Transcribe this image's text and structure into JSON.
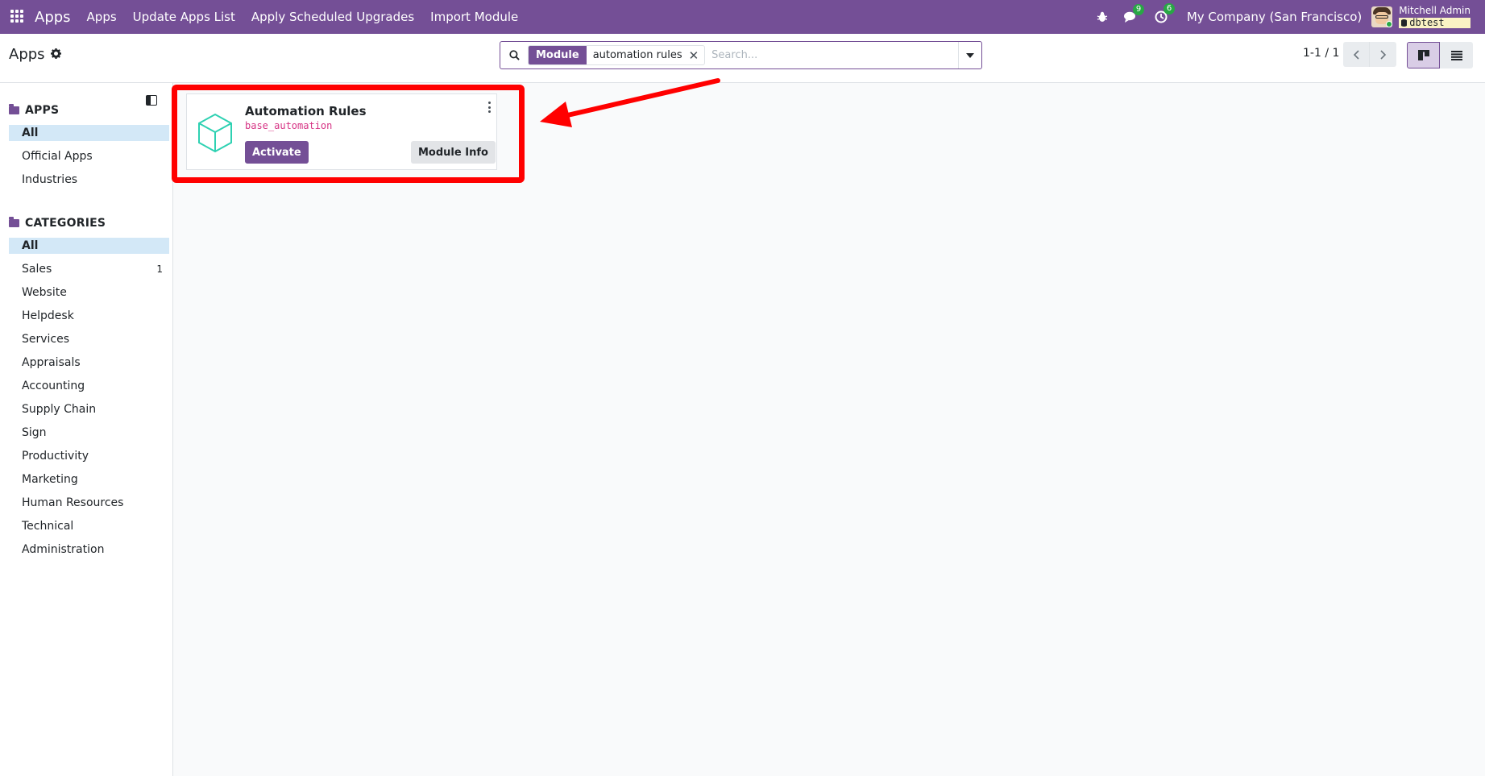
{
  "navbar": {
    "brand": "Apps",
    "menu": [
      "Apps",
      "Update Apps List",
      "Apply Scheduled Upgrades",
      "Import Module"
    ],
    "messages_count": "9",
    "activities_count": "6",
    "company": "My Company (San Francisco)",
    "user_name": "Mitchell Admin",
    "db_name": "dbtest"
  },
  "control": {
    "breadcrumb": "Apps",
    "search": {
      "facet_label": "Module",
      "facet_value": "automation rules",
      "placeholder": "Search..."
    },
    "pager": {
      "value": "1-1 / 1"
    }
  },
  "sidebar": {
    "apps_heading": "APPS",
    "apps_items": [
      "All",
      "Official Apps",
      "Industries"
    ],
    "categories_heading": "CATEGORIES",
    "category_items": [
      "All",
      "Sales",
      "Website",
      "Helpdesk",
      "Services",
      "Appraisals",
      "Accounting",
      "Supply Chain",
      "Sign",
      "Productivity",
      "Marketing",
      "Human Resources",
      "Technical",
      "Administration"
    ],
    "sales_count": "1"
  },
  "card": {
    "title": "Automation Rules",
    "technical_name": "base_automation",
    "activate_label": "Activate",
    "info_label": "Module Info"
  },
  "colors": {
    "brand": "#744f96",
    "highlight": "#ff0000",
    "module_icon": "#2ed1b2",
    "active_filter_bg": "#d3e8f7"
  },
  "icons": {
    "app_grid": "grid-icon",
    "bug": "bug-icon",
    "messages": "chat-icon",
    "activities": "clock-icon",
    "database": "database-icon",
    "search": "search-icon",
    "remove": "close-icon",
    "kanban": "kanban-icon",
    "list": "list-icon"
  }
}
